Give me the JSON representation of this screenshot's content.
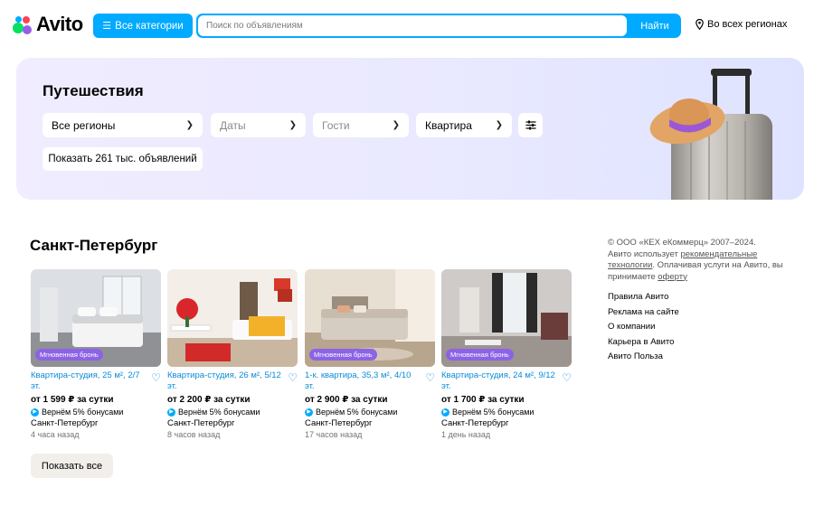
{
  "header": {
    "logo_text": "Avito",
    "categories_label": "Все категории",
    "search_placeholder": "Поиск по объявлениям",
    "search_button": "Найти",
    "region_label": "Во всех регионах"
  },
  "banner": {
    "title": "Путешествия",
    "region_select": "Все регионы",
    "dates_select": "Даты",
    "guests_select": "Гости",
    "type_select": "Квартира",
    "show_button": "Показать 261 тыс. объявлений"
  },
  "section": {
    "title": "Санкт-Петербург",
    "show_all": "Показать все"
  },
  "listings": [
    {
      "badge": "Мгновенная бронь",
      "title": "Квартира-студия, 25 м², 2/7 эт.",
      "price": "от 1 599 ₽ за сутки",
      "bonus": "Вернём 5% бонусами",
      "city": "Санкт-Петербург",
      "time": "4 часа назад"
    },
    {
      "badge": "",
      "title": "Квартира-студия, 26 м², 5/12 эт.",
      "price": "от 2 200 ₽ за сутки",
      "bonus": "Вернём 5% бонусами",
      "city": "Санкт-Петербург",
      "time": "8 часов назад"
    },
    {
      "badge": "Мгновенная бронь",
      "title": "1-к. квартира, 35,3 м², 4/10 эт.",
      "price": "от 2 900 ₽ за сутки",
      "bonus": "Вернём 5% бонусами",
      "city": "Санкт-Петербург",
      "time": "17 часов назад"
    },
    {
      "badge": "Мгновенная бронь",
      "title": "Квартира-студия, 24 м², 9/12 эт.",
      "price": "от 1 700 ₽ за сутки",
      "bonus": "Вернём 5% бонусами",
      "city": "Санкт-Петербург",
      "time": "1 день назад"
    }
  ],
  "footer": {
    "copyright": "© ООО «КЕХ еКоммерц» 2007–2024.",
    "rec_text_1": "Авито использует",
    "rec_link": "рекомендательные технологии",
    "rec_text_2": ". Оплачивая услуги на Авито, вы принимаете",
    "offer_link": "оферту",
    "links": [
      "Правила Авито",
      "Реклама на сайте",
      "О компании",
      "Карьера в Авито",
      "Авито Польза"
    ]
  },
  "colors": {
    "accent": "#00aaff",
    "badge": "#8c63e6",
    "link": "#0a8ad8"
  }
}
